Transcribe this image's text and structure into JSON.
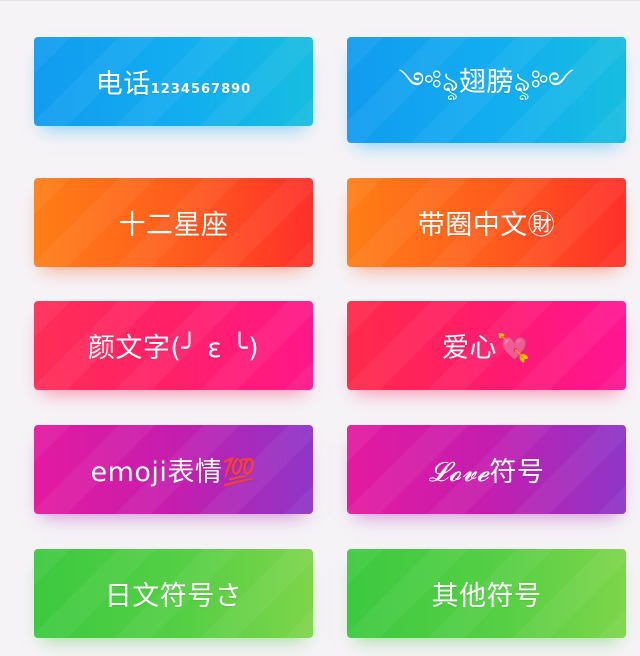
{
  "cards": [
    {
      "label": "电话",
      "sub": "1234567890",
      "theme": "blue"
    },
    {
      "label": "༺ৡ翅膀ৡ༻",
      "theme": "blue"
    },
    {
      "label": "十二星座",
      "theme": "orange"
    },
    {
      "label": "带圈中文㊖",
      "theme": "orange"
    },
    {
      "label": "颜文字(╯ ε ╰)",
      "theme": "pink"
    },
    {
      "label": "爱心💘",
      "theme": "pink"
    },
    {
      "label": "emoji表情💯",
      "theme": "purple"
    },
    {
      "label_script": "𝓛𝓸𝓿𝓮",
      "label": "符号",
      "theme": "purple"
    },
    {
      "label": "日文符号さ",
      "theme": "green"
    },
    {
      "label": "其他符号",
      "theme": "green"
    }
  ],
  "colors": {
    "background": "#f6f3f7",
    "blue": "#12aef0",
    "orange": "#ff5a1e",
    "pink": "#ff2069",
    "purple": "#c51dae",
    "green": "#56cf45"
  }
}
